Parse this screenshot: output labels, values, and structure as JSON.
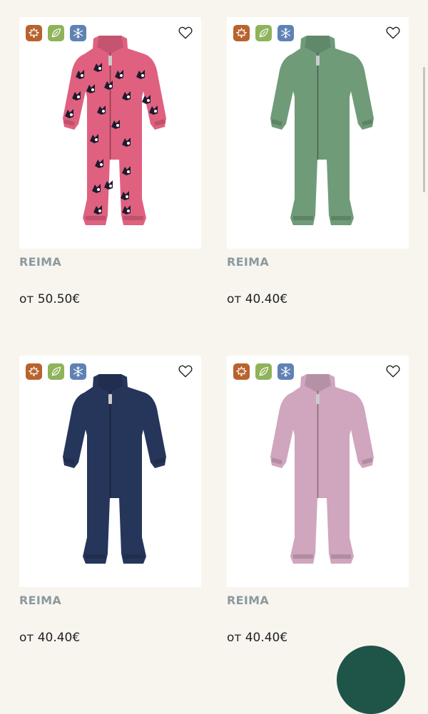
{
  "products": [
    {
      "brand": "REIMA",
      "price": "от 50.50€",
      "color": "#e0607f",
      "pattern": "print",
      "badges": [
        "autumn-leaf-icon",
        "eco-leaf-icon",
        "snowflake-icon"
      ]
    },
    {
      "brand": "REIMA",
      "price": "от 40.40€",
      "color": "#6f9b79",
      "pattern": "plain",
      "badges": [
        "autumn-leaf-icon",
        "eco-leaf-icon",
        "snowflake-icon"
      ]
    },
    {
      "brand": "REIMA",
      "price": "от 40.40€",
      "color": "#26355a",
      "pattern": "plain",
      "badges": [
        "autumn-leaf-icon",
        "eco-leaf-icon",
        "snowflake-icon"
      ]
    },
    {
      "brand": "REIMA",
      "price": "от 40.40€",
      "color": "#cfa6bd",
      "pattern": "plain",
      "badges": [
        "autumn-leaf-icon",
        "eco-leaf-icon",
        "snowflake-icon"
      ]
    }
  ],
  "badge_colors": {
    "autumn": "#b8632e",
    "eco": "#8fb35a",
    "winter": "#5f82b4"
  }
}
